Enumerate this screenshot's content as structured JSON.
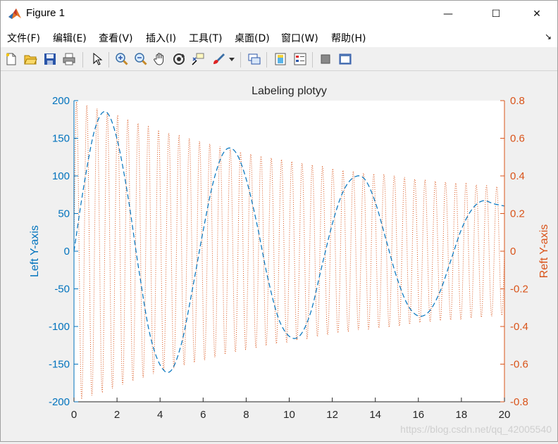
{
  "window": {
    "title": "Figure 1",
    "minimize": "—",
    "maximize": "☐",
    "close": "✕"
  },
  "menu": {
    "items": [
      "文件(F)",
      "编辑(E)",
      "查看(V)",
      "插入(I)",
      "工具(T)",
      "桌面(D)",
      "窗口(W)",
      "帮助(H)"
    ],
    "arrow": "↘"
  },
  "toolbar": {
    "icons": [
      "new-figure-icon",
      "open-file-icon",
      "save-icon",
      "print-icon",
      "select-arrow-icon",
      "zoom-in-icon",
      "zoom-out-icon",
      "pan-hand-icon",
      "rotate-3d-icon",
      "data-cursor-icon",
      "brush-icon",
      "brush-dropdown-icon",
      "link-plot-icon",
      "insert-colorbar-icon",
      "insert-legend-icon",
      "hide-plot-tools-icon",
      "show-plot-tools-icon"
    ]
  },
  "watermark": "https://blog.csdn.net/qq_42005540",
  "chart_data": {
    "type": "line",
    "title": "Labeling plotyy",
    "xlim": [
      0,
      20
    ],
    "xticks": [
      "0",
      "2",
      "4",
      "6",
      "8",
      "10",
      "12",
      "14",
      "16",
      "18",
      "20"
    ],
    "left_axis": {
      "label": "Left Y-axis",
      "ylim": [
        -200,
        200
      ],
      "ticks": [
        "200",
        "150",
        "100",
        "50",
        "0",
        "-50",
        "-100",
        "-150",
        "-200"
      ],
      "color": "#0072bd"
    },
    "right_axis": {
      "label": "Reft Y-axis",
      "ylim": [
        -0.8,
        0.8
      ],
      "ticks": [
        "0.8",
        "0.6",
        "0.4",
        "0.2",
        "0",
        "-0.2",
        "-0.4",
        "-0.6",
        "-0.8"
      ],
      "color": "#d95319"
    },
    "series": [
      {
        "axis": "left",
        "style": "dashed",
        "color": "#0072bd",
        "x": [
          0,
          0.5,
          1,
          1.5,
          2,
          2.5,
          3,
          3.5,
          4,
          4.5,
          5,
          5.5,
          6,
          6.5,
          7,
          7.5,
          8,
          8.5,
          9,
          9.5,
          10,
          10.5,
          11,
          11.5,
          12,
          12.5,
          13,
          13.5,
          14,
          14.5,
          15,
          15.5,
          16,
          16.5,
          17,
          17.5,
          18,
          18.5,
          19,
          19.5,
          20
        ],
        "y": [
          0,
          94,
          165,
          185,
          149,
          74,
          -22,
          -107,
          -151,
          -159,
          -122,
          -51,
          27,
          95,
          133,
          132,
          96,
          36,
          -35,
          -89,
          -113,
          -112,
          -81,
          -22,
          36,
          79,
          98,
          96,
          65,
          15,
          -35,
          -71,
          -86,
          -80,
          -54,
          -13,
          29,
          56,
          67,
          63,
          60
        ]
      },
      {
        "axis": "right",
        "style": "dotted",
        "color": "#d95319",
        "x": [
          0,
          1,
          2,
          3,
          4,
          5,
          6,
          7,
          8,
          9,
          10,
          11,
          12,
          13,
          14,
          15,
          16,
          17,
          18,
          19,
          20
        ],
        "envelope": [
          0.8,
          0.76,
          0.72,
          0.68,
          0.64,
          0.61,
          0.58,
          0.55,
          0.52,
          0.5,
          0.48,
          0.46,
          0.44,
          0.42,
          0.41,
          0.4,
          0.38,
          0.37,
          0.36,
          0.35,
          0.34
        ],
        "cycles_per_unit": 2.1
      }
    ],
    "grid": false
  }
}
